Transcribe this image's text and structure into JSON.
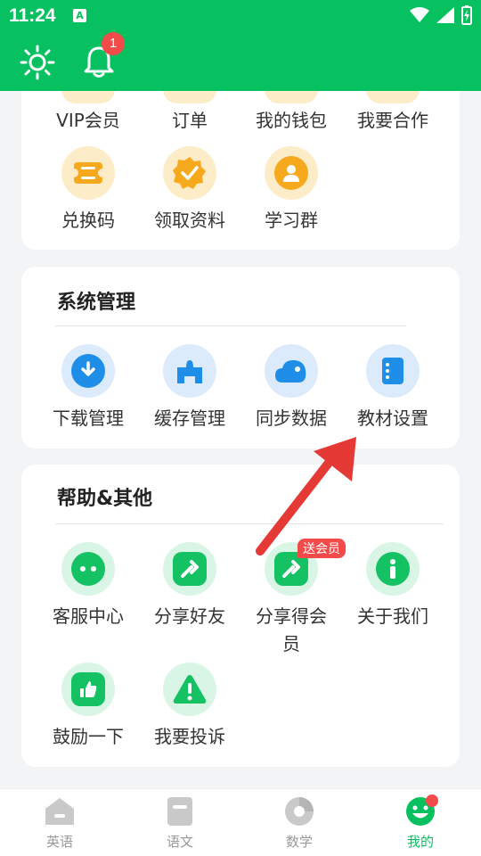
{
  "status_bar": {
    "time": "11:24",
    "app_letter": "A"
  },
  "header": {
    "notification_count": "1"
  },
  "section1": {
    "items": [
      {
        "label": "VIP会员"
      },
      {
        "label": "订单"
      },
      {
        "label": "我的钱包"
      },
      {
        "label": "我要合作"
      },
      {
        "label": "兑换码",
        "icon": "ticket-icon"
      },
      {
        "label": "领取资料",
        "icon": "check-badge-icon"
      },
      {
        "label": "学习群",
        "icon": "person-icon"
      }
    ]
  },
  "system": {
    "title": "系统管理",
    "items": [
      {
        "label": "下载管理",
        "icon": "download-icon"
      },
      {
        "label": "缓存管理",
        "icon": "puzzle-icon"
      },
      {
        "label": "同步数据",
        "icon": "cloud-icon"
      },
      {
        "label": "教材设置",
        "icon": "book-icon"
      }
    ]
  },
  "help": {
    "title": "帮助&其他",
    "badge": "送会员",
    "items": [
      {
        "label": "客服中心",
        "icon": "chat-icon"
      },
      {
        "label": "分享好友",
        "icon": "share-icon"
      },
      {
        "label": "分享得会\n员",
        "icon": "share-icon"
      },
      {
        "label": "关于我们",
        "icon": "info-icon"
      },
      {
        "label": "鼓励一下",
        "icon": "thumbs-up-icon"
      },
      {
        "label": "我要投诉",
        "icon": "warning-icon"
      }
    ]
  },
  "tabs": [
    {
      "label": "英语"
    },
    {
      "label": "语文"
    },
    {
      "label": "数学"
    },
    {
      "label": "我的",
      "active": true
    }
  ],
  "colors": {
    "brand": "#07c160",
    "orange": "#f7a91e",
    "blue": "#1f8ee9",
    "red": "#f34a4a",
    "arrow": "#e53935"
  }
}
